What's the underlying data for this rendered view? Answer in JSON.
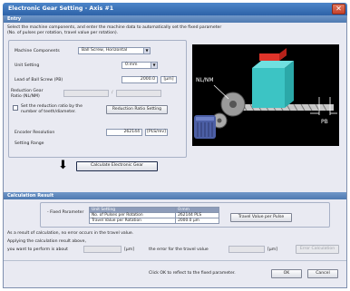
{
  "window": {
    "title": "Electronic Gear Setting - Axis #1",
    "close_glyph": "✕"
  },
  "entry": {
    "section_title": "Entry",
    "instructions_1": "Select the machine components, and enter the machine data to automatically set the fixed parameter",
    "instructions_2": "(No. of pulses per rotation, travel value per rotation).",
    "machine_components": {
      "label": "Machine Components",
      "value": "Ball Screw, Horizontal"
    },
    "unit_setting": {
      "label": "Unit Setting",
      "value": "0:mm"
    },
    "lead_ball_screw": {
      "label": "Lead of Ball Screw (PB)",
      "value": "2000.0",
      "unit": "[μm]"
    },
    "reduction_ratio": {
      "label_1": "Reduction Gear",
      "label_2": "Ratio (NL/NM)",
      "left_value": "",
      "right_value": ""
    },
    "set_ratio_option": {
      "label_1": "Set the reduction ratio by the",
      "label_2": "number of teeth/diameter.",
      "checked": false
    },
    "reduction_ratio_button": "Reduction Ratio Setting",
    "encoder_resolution": {
      "label": "Encoder Resolution",
      "value": "262144",
      "unit": "[PLS/rev]"
    },
    "setting_range": {
      "label": "Setting Range",
      "value": ""
    },
    "diagram_labels": {
      "ratio": "NL/NM",
      "pitch": "PB"
    },
    "calculate_button": "Calculate Electronic Gear",
    "down_arrow": "⬇"
  },
  "calculation_result": {
    "section_title": "Calculation Result",
    "fixed_parameter_label": "- Fixed Parameter",
    "table": {
      "headers": [
        "Unit Setting",
        "0:mm"
      ],
      "rows": [
        [
          "No. of Pulses per Rotation",
          "262144 PLS"
        ],
        [
          "Travel Value per Rotation",
          "2000.0 μm"
        ]
      ]
    },
    "travel_value_button": "Travel Value per Pulse",
    "note": "As a result of calculation, no error occurs in the travel value.",
    "apply_label": "Applying the calculation result above,",
    "perform_label": "you want to perform is about",
    "perform_value": "",
    "perform_unit": "[μm]",
    "error_label": "the error for the travel value",
    "error_value": "",
    "error_unit": "[μm]",
    "error_calc_button": "Error Calculation",
    "footer_note": "Click OK to reflect to the fixed parameter.",
    "ok_button": "OK",
    "cancel_button": "Cancel"
  }
}
